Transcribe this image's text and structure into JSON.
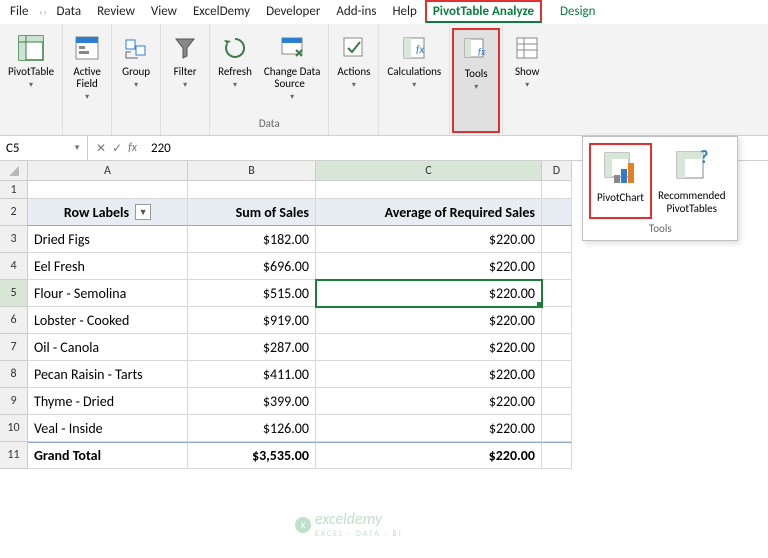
{
  "tabs": {
    "file": "File",
    "data": "Data",
    "review": "Review",
    "view": "View",
    "exceldemy": "ExcelDemy",
    "developer": "Developer",
    "addins": "Add-ins",
    "help": "Help",
    "pta": "PivotTable Analyze",
    "design": "Design"
  },
  "ribbon": {
    "pivottable": "PivotTable",
    "activefield": "Active\nField",
    "group": "Group",
    "filter": "Filter",
    "refresh": "Refresh",
    "changeds": "Change Data\nSource  ",
    "actions": "Actions",
    "calculations": "Calculations",
    "tools": "Tools",
    "show": "Show",
    "group_data": "Data"
  },
  "tools_panel": {
    "pivotchart": "PivotChart",
    "recommended": "Recommended\nPivotTables",
    "label": "Tools"
  },
  "namebox": "C5",
  "fx_label": "fx",
  "formula": "220",
  "cols": {
    "A": "A",
    "B": "B",
    "C": "C",
    "D": "D"
  },
  "pivot": {
    "header": {
      "rowlabels": "Row Labels",
      "sum": "Sum of Sales",
      "avg": "Average of Required Sales"
    },
    "rows": [
      {
        "n": "3",
        "a": "Dried Figs",
        "b": "$182.00",
        "c": "$220.00"
      },
      {
        "n": "4",
        "a": "Eel Fresh",
        "b": "$696.00",
        "c": "$220.00"
      },
      {
        "n": "5",
        "a": "Flour - Semolina",
        "b": "$515.00",
        "c": "$220.00"
      },
      {
        "n": "6",
        "a": "Lobster - Cooked",
        "b": "$919.00",
        "c": "$220.00"
      },
      {
        "n": "7",
        "a": "Oil - Canola",
        "b": "$287.00",
        "c": "$220.00"
      },
      {
        "n": "8",
        "a": "Pecan Raisin - Tarts",
        "b": "$411.00",
        "c": "$220.00"
      },
      {
        "n": "9",
        "a": "Thyme - Dried",
        "b": "$399.00",
        "c": "$220.00"
      },
      {
        "n": "10",
        "a": "Veal - Inside",
        "b": "$126.00",
        "c": "$220.00"
      }
    ],
    "total": {
      "n": "11",
      "a": "Grand Total",
      "b": "$3,535.00",
      "c": "$220.00"
    }
  },
  "watermark": {
    "brand": "exceldemy",
    "tag": "EXCEL · DATA · BI"
  }
}
